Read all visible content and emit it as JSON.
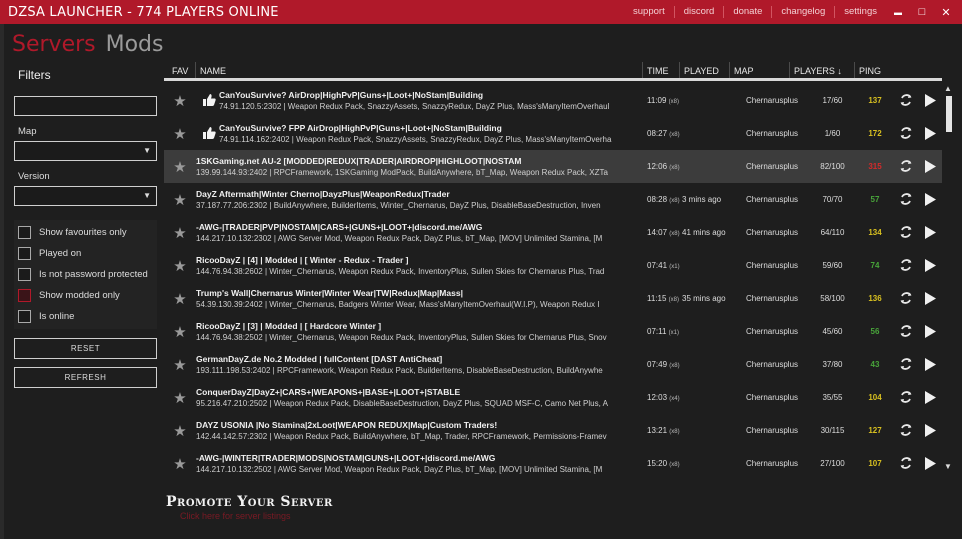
{
  "titlebar": {
    "title": "DZSA LAUNCHER - 774 PLAYERS ONLINE",
    "links": [
      "support",
      "discord",
      "donate",
      "changelog",
      "settings"
    ],
    "minimize": "▬",
    "maximize": "□",
    "close": "✕"
  },
  "tabs": {
    "servers": "Servers",
    "mods": "Mods"
  },
  "filters": {
    "heading": "Filters",
    "search_value": "",
    "map_label": "Map",
    "map_value": "",
    "version_label": "Version",
    "version_value": "",
    "checkboxes": [
      {
        "label": "Show favourites only",
        "checked": false
      },
      {
        "label": "Played on",
        "checked": false
      },
      {
        "label": "Is not password protected",
        "checked": false
      },
      {
        "label": "Show modded only",
        "checked": true
      },
      {
        "label": "Is online",
        "checked": false
      }
    ],
    "reset": "RESET",
    "refresh": "REFRESH"
  },
  "table": {
    "columns": [
      "FAV",
      "NAME",
      "TIME",
      "PLAYED",
      "MAP",
      "PLAYERS ↓",
      "PING"
    ],
    "rows": [
      {
        "name": "CanYouSurvive? AirDrop|HighPvP|Guns+|Loot+|NoStam|Building",
        "mods": "74.91.120.5:2302 | Weapon Redux Pack, SnazzyAssets, SnazzyRedux, DayZ Plus, Mass'sManyItemOverhaul",
        "time": "11:09",
        "time_mult": "(x8)",
        "played": "",
        "map": "Chernarusplus",
        "players": "17/60",
        "ping": "137",
        "ping_color": "#d8c020",
        "thumb": true
      },
      {
        "name": "CanYouSurvive? FPP AirDrop|HighPvP|Guns+|Loot+|NoStam|Building",
        "mods": "74.91.114.162:2402 | Weapon Redux Pack, SnazzyAssets, SnazzyRedux, DayZ Plus, Mass'sManyItemOverha",
        "time": "08:27",
        "time_mult": "(x8)",
        "played": "",
        "map": "Chernarusplus",
        "players": "1/60",
        "ping": "172",
        "ping_color": "#d8c020",
        "thumb": true
      },
      {
        "name": "1SKGaming.net AU-2 [MODDED|REDUX|TRADER|AIRDROP|HIGHLOOT|NOSTAM",
        "mods": "139.99.144.93:2402 | RPCFramework, 1SKGaming ModPack, BuildAnywhere, bT_Map, Weapon Redux Pack, XZTa",
        "time": "12:06",
        "time_mult": "(x8)",
        "played": "",
        "map": "Chernarusplus",
        "players": "82/100",
        "ping": "315",
        "ping_color": "#d42a2a",
        "thumb": false
      },
      {
        "name": "DayZ Aftermath|Winter Cherno|DayzPlus|WeaponRedux|Trader",
        "mods": "37.187.77.206:2302 | BuildAnywhere, BuilderItems, Winter_Chernarus, DayZ Plus, DisableBaseDestruction, Inven",
        "time": "08:28",
        "time_mult": "(x8)",
        "played": "3 mins ago",
        "map": "Chernarusplus",
        "players": "70/70",
        "ping": "57",
        "ping_color": "#48a43a",
        "thumb": false
      },
      {
        "name": "-AWG-|TRADER|PVP|NOSTAM|CARS+|GUNS+|LOOT+|discord.me/AWG",
        "mods": "144.217.10.132:2302 | AWG Server Mod, Weapon Redux Pack, DayZ Plus, bT_Map, [MOV] Unlimited Stamina, [M",
        "time": "14:07",
        "time_mult": "(x8)",
        "played": "41 mins ago",
        "map": "Chernarusplus",
        "players": "64/110",
        "ping": "134",
        "ping_color": "#d8c020",
        "thumb": false
      },
      {
        "name": "RicooDayZ | [4] | Modded | [ Winter - Redux - Trader ]",
        "mods": "144.76.94.38:2602 | Winter_Chernarus, Weapon Redux Pack, InventoryPlus, Sullen Skies for Chernarus Plus, Trad",
        "time": "07:41",
        "time_mult": "(x1)",
        "played": "",
        "map": "Chernarusplus",
        "players": "59/60",
        "ping": "74",
        "ping_color": "#48a43a",
        "thumb": false
      },
      {
        "name": "Trump's Wall|Chernarus Winter|Winter Wear|TW|Redux|Map|Mass|",
        "mods": "54.39.130.39:2402 | Winter_Chernarus, Badgers Winter Wear, Mass'sManyItemOverhaul(W.I.P), Weapon Redux I",
        "time": "11:15",
        "time_mult": "(x8)",
        "played": "35 mins ago",
        "map": "Chernarusplus",
        "players": "58/100",
        "ping": "136",
        "ping_color": "#d8c020",
        "thumb": false
      },
      {
        "name": "RicooDayZ | [3] | Modded | [ Hardcore Winter ]",
        "mods": "144.76.94.38:2502 | Winter_Chernarus, Weapon Redux Pack, InventoryPlus, Sullen Skies for Chernarus Plus, Snov",
        "time": "07:11",
        "time_mult": "(x1)",
        "played": "",
        "map": "Chernarusplus",
        "players": "45/60",
        "ping": "56",
        "ping_color": "#48a43a",
        "thumb": false
      },
      {
        "name": "GermanDayZ.de No.2 Modded | fullContent [DAST AntiCheat]",
        "mods": "193.111.198.53:2402 | RPCFramework, Weapon Redux Pack, BuilderItems, DisableBaseDestruction, BuildAnywhe",
        "time": "07:49",
        "time_mult": "(x8)",
        "played": "",
        "map": "Chernarusplus",
        "players": "37/80",
        "ping": "43",
        "ping_color": "#48a43a",
        "thumb": false
      },
      {
        "name": "ConquerDayZ|DayZ+|CARS+|WEAPONS+|BASE+|LOOT+|STABLE",
        "mods": "95.216.47.210:2502 | Weapon Redux Pack, DisableBaseDestruction, DayZ Plus, SQUAD MSF-C, Camo Net Plus, A",
        "time": "12:03",
        "time_mult": "(x4)",
        "played": "",
        "map": "Chernarusplus",
        "players": "35/55",
        "ping": "104",
        "ping_color": "#d8c020",
        "thumb": false
      },
      {
        "name": "DAYZ USONIA |No Stamina|2xLoot|WEAPON REDUX|Map|Custom Traders!",
        "mods": "142.44.142.57:2302 | Weapon Redux Pack, BuildAnywhere, bT_Map, Trader, RPCFramework, Permissions-Framev",
        "time": "13:21",
        "time_mult": "(x8)",
        "played": "",
        "map": "Chernarusplus",
        "players": "30/115",
        "ping": "127",
        "ping_color": "#d8c020",
        "thumb": false
      },
      {
        "name": "-AWG-|WINTER|TRADER|MODS|NOSTAM|GUNS+|LOOT+|discord.me/AWG",
        "mods": "144.217.10.132:2502 | AWG Server Mod, Weapon Redux Pack, DayZ Plus, bT_Map, [MOV] Unlimited Stamina, [M",
        "time": "15:20",
        "time_mult": "(x8)",
        "played": "",
        "map": "Chernarusplus",
        "players": "27/100",
        "ping": "107",
        "ping_color": "#d8c020",
        "thumb": false
      }
    ]
  },
  "promo": {
    "title": "Promote Your Server",
    "subtitle": "Click here for server listings"
  }
}
